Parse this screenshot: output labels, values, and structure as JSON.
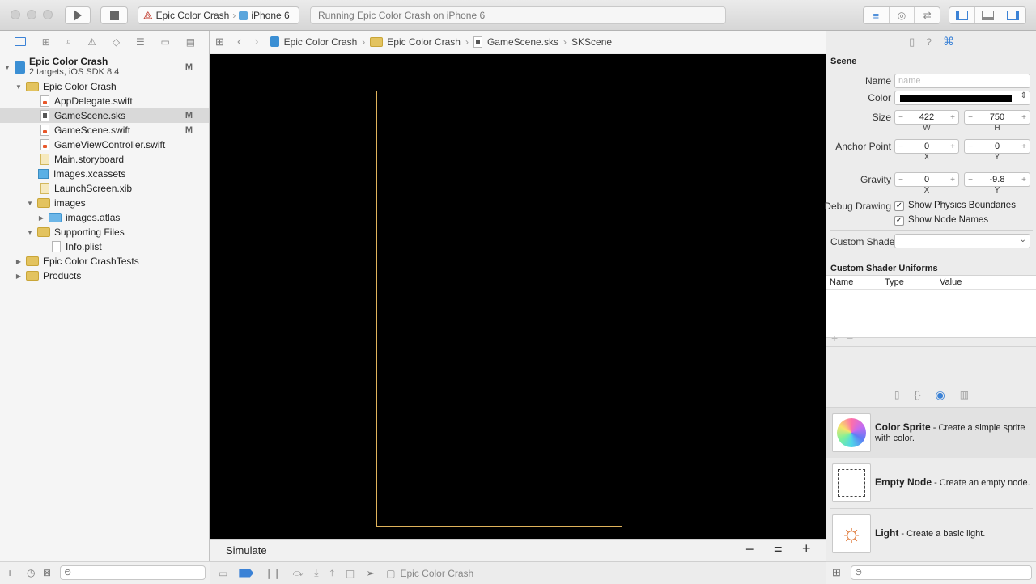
{
  "toolbar": {
    "scheme": "Epic Color Crash",
    "device": "iPhone 6",
    "activity": "Running Epic Color Crash on iPhone 6"
  },
  "navigator": {
    "project": {
      "name": "Epic Color Crash",
      "subtitle": "2 targets, iOS SDK 8.4",
      "badge": "M"
    },
    "items": [
      {
        "label": "Epic Color Crash",
        "badge": ""
      },
      {
        "label": "AppDelegate.swift",
        "badge": ""
      },
      {
        "label": "GameScene.sks",
        "badge": "M"
      },
      {
        "label": "GameScene.swift",
        "badge": "M"
      },
      {
        "label": "GameViewController.swift",
        "badge": ""
      },
      {
        "label": "Main.storyboard",
        "badge": ""
      },
      {
        "label": "Images.xcassets",
        "badge": ""
      },
      {
        "label": "LaunchScreen.xib",
        "badge": ""
      },
      {
        "label": "images",
        "badge": ""
      },
      {
        "label": "images.atlas",
        "badge": ""
      },
      {
        "label": "Supporting Files",
        "badge": ""
      },
      {
        "label": "Info.plist",
        "badge": ""
      },
      {
        "label": "Epic Color CrashTests",
        "badge": ""
      },
      {
        "label": "Products",
        "badge": ""
      }
    ]
  },
  "jumpbar": {
    "crumbs": [
      "Epic Color Crash",
      "Epic Color Crash",
      "GameScene.sks",
      "SKScene"
    ]
  },
  "editor": {
    "simulate": "Simulate",
    "scene_border_color": "#e0b35c",
    "background": "#000000"
  },
  "debugbar": {
    "target": "Epic Color Crash"
  },
  "inspector": {
    "section": "Scene",
    "name_label": "Name",
    "name_placeholder": "name",
    "color_label": "Color",
    "color_value": "#000000",
    "size_label": "Size",
    "size_w": "422",
    "size_h": "750",
    "w": "W",
    "h": "H",
    "anchor_label": "Anchor Point",
    "anchor_x": "0",
    "anchor_y": "0",
    "x": "X",
    "y": "Y",
    "gravity_label": "Gravity",
    "gravity_x": "0",
    "gravity_y": "-9.8",
    "debug_label": "Debug Drawing",
    "show_physics": "Show Physics Boundaries",
    "show_names": "Show Node Names",
    "shader_label": "Custom Shader",
    "uniforms_title": "Custom Shader Uniforms",
    "col_name": "Name",
    "col_type": "Type",
    "col_value": "Value"
  },
  "library": [
    {
      "title": "Color Sprite",
      "desc": " - Create a simple sprite with color."
    },
    {
      "title": "Empty Node",
      "desc": " - Create an empty node."
    },
    {
      "title": "Light",
      "desc": " - Create a basic light."
    }
  ]
}
